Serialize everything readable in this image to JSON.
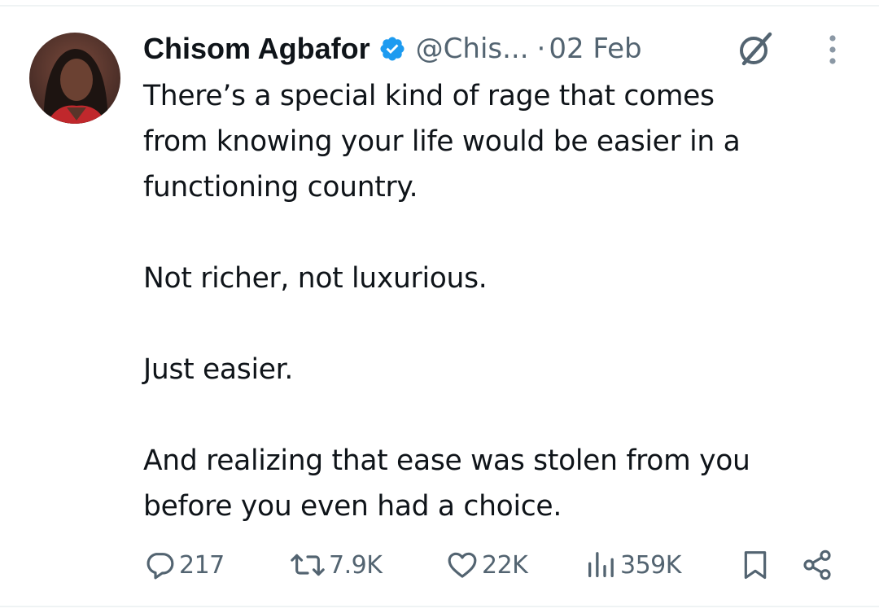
{
  "author": {
    "display_name": "Chisom Agbafor",
    "handle": "@Chis...",
    "separator": "·",
    "date": "02 Feb",
    "verified": true,
    "verified_color": "#1d9bf0"
  },
  "tweet": {
    "paragraphs": [
      "There’s a special kind of rage that comes from knowing your life would be easier in a functioning country.",
      "Not richer, not luxurious.",
      "Just easier.",
      "And realizing that ease was stolen from you before you even had a choice."
    ],
    "lines": {
      "p1_l1": "There’s a special kind of rage that comes",
      "p1_l2": "from knowing your life would be easier in a",
      "p1_l3": "functioning country.",
      "p2_l1": "Not richer, not luxurious.",
      "p3_l1": "Just easier.",
      "p4_l1": "And realizing that ease was stolen from you",
      "p4_l2": "before you even had a choice."
    }
  },
  "metrics": {
    "replies": "217",
    "reposts": "7.9K",
    "likes": "22K",
    "views": "359K"
  },
  "icons": {
    "grok": "grok-icon",
    "more": "more-vertical-icon",
    "reply": "reply-icon",
    "repost": "repost-icon",
    "like": "heart-icon",
    "views": "views-chart-icon",
    "bookmark": "bookmark-icon",
    "share": "share-icon"
  },
  "colors": {
    "text": "#0f1419",
    "secondary": "#536471",
    "accent": "#1d9bf0"
  }
}
